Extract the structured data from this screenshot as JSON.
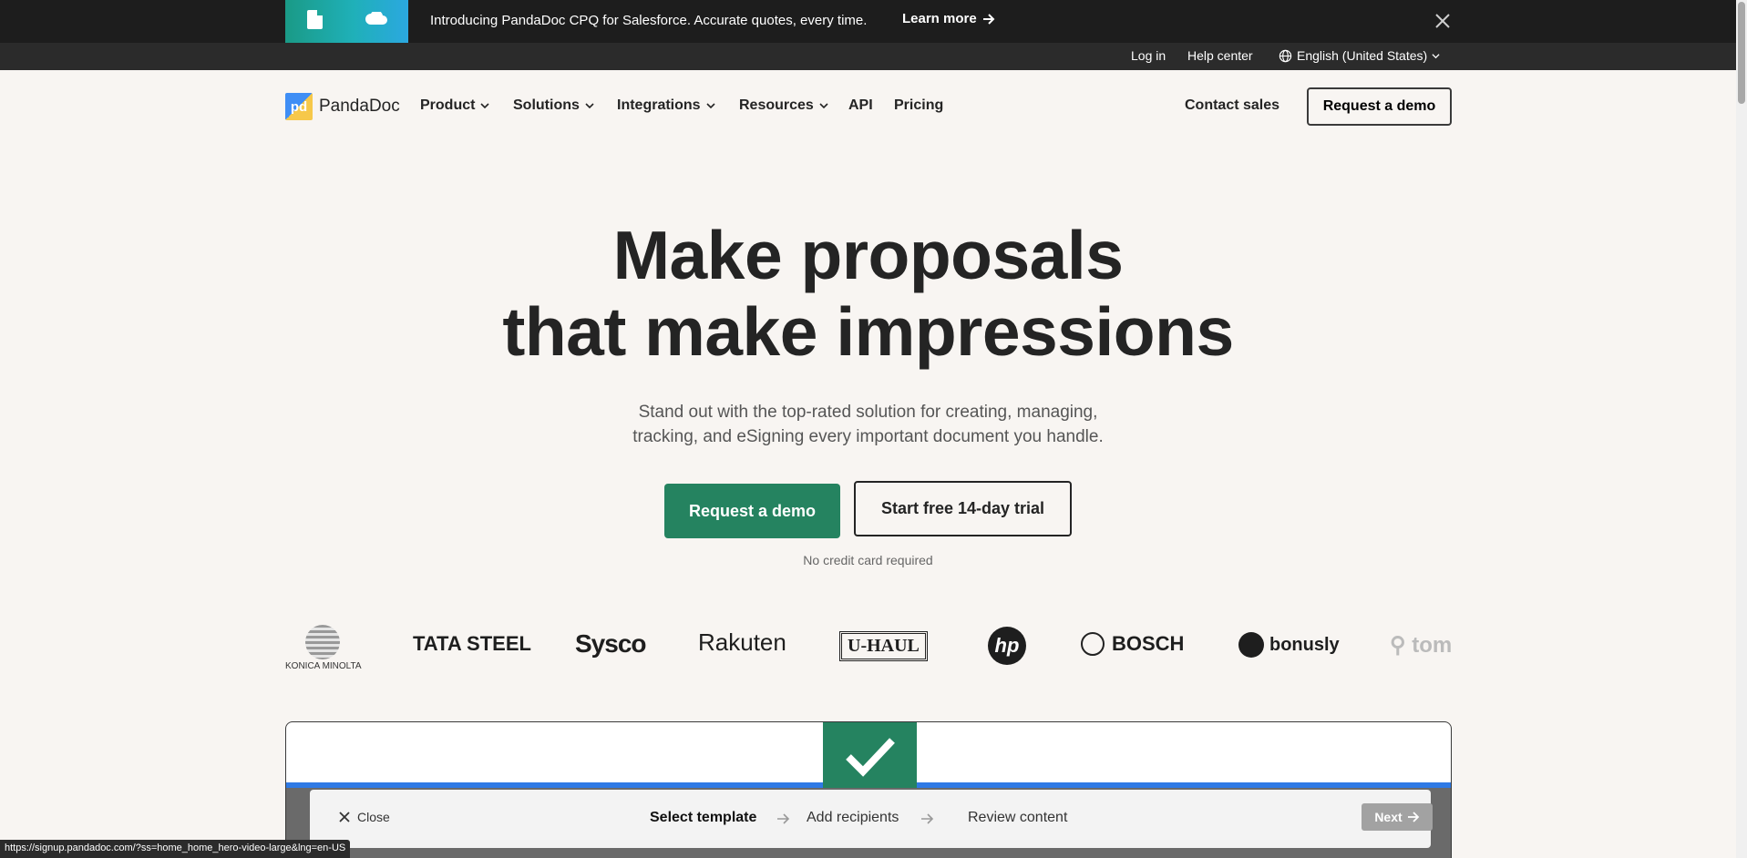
{
  "announcement": {
    "message": "Introducing PandaDoc CPQ for Salesforce. Accurate quotes, every time.",
    "cta": "Learn more"
  },
  "utility": {
    "login": "Log in",
    "help": "Help center",
    "language": "English (United States)"
  },
  "nav": {
    "logo_mark": "pd",
    "logo": "PandaDoc",
    "items": [
      "Product",
      "Solutions",
      "Integrations",
      "Resources",
      "API",
      "Pricing"
    ],
    "contact": "Contact sales",
    "demo": "Request a demo"
  },
  "hero": {
    "title_line1": "Make proposals",
    "title_line2": "that make impressions",
    "subtitle_line1": "Stand out with the top-rated solution for creating, managing,",
    "subtitle_line2": "tracking, and eSigning every important document you handle.",
    "primary_cta": "Request a demo",
    "secondary_cta": "Start free 14-day trial",
    "note": "No credit card required"
  },
  "customer_logos": {
    "konica": "KONICA MINOLTA",
    "tata": "TATA STEEL",
    "sysco": "Sysco",
    "rakuten": "Rakuten",
    "uhaul": "U-HAUL",
    "hp": "hp",
    "bosch": "BOSCH",
    "bonusly": "bonusly",
    "tom": "tom"
  },
  "preview": {
    "close": "Close",
    "steps": [
      "Select template",
      "Add recipients",
      "Review content"
    ],
    "next": "Next"
  },
  "status_url": "https://signup.pandadoc.com/?ss=home_home_hero-video-large&lng=en-US",
  "colors": {
    "brand_green": "#258360",
    "background": "#f8f5f2",
    "announcement_bg": "#1d1d1d"
  }
}
